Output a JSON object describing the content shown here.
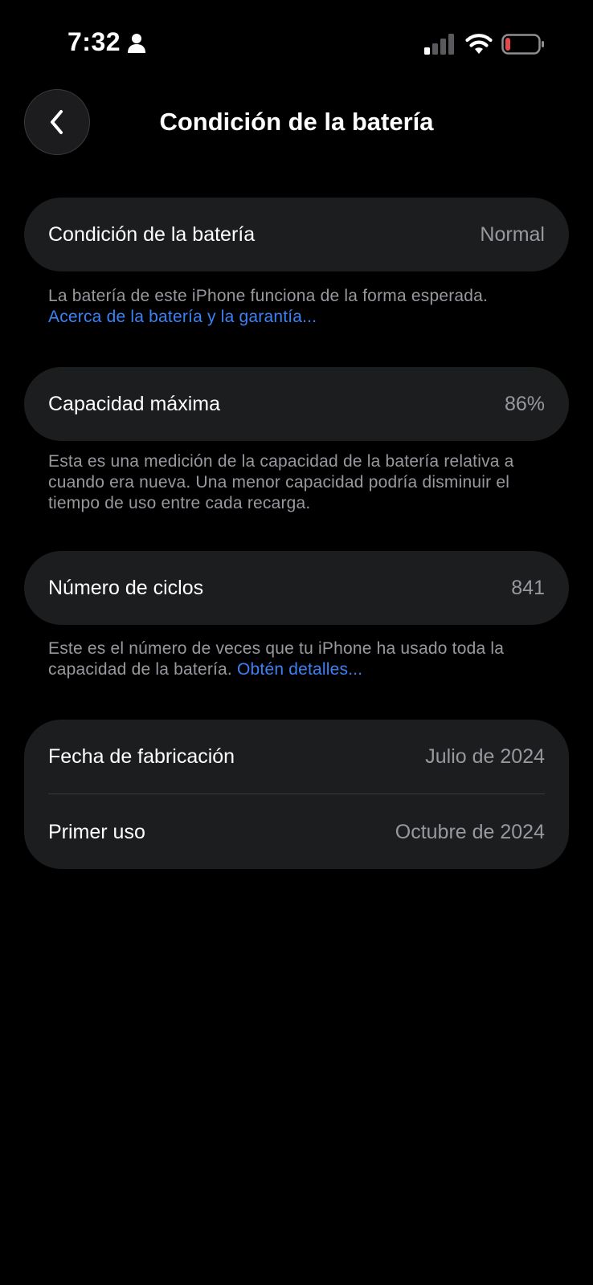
{
  "status_bar": {
    "time": "7:32",
    "battery_color": "#e5484d"
  },
  "header": {
    "title": "Condición de la batería"
  },
  "health": {
    "label": "Condición de la batería",
    "value": "Normal",
    "footnote": "La batería de este iPhone funciona de la forma esperada.",
    "link": "Acerca de la batería y la garantía..."
  },
  "capacity": {
    "label": "Capacidad máxima",
    "value": "86%",
    "footnote": "Esta es una medición de la capacidad de la batería relativa a cuando era nueva. Una menor capacidad podría disminuir el tiempo de uso entre cada recarga."
  },
  "cycles": {
    "label": "Número de ciclos",
    "value": "841",
    "footnote": "Este es el número de veces que tu iPhone ha usado toda la capacidad de la batería.",
    "link": "Obtén detalles..."
  },
  "dates": {
    "manufacture_label": "Fecha de fabricación",
    "manufacture_value": "Julio de 2024",
    "first_use_label": "Primer uso",
    "first_use_value": "Octubre de 2024"
  },
  "colors": {
    "background": "#000000",
    "card": "#1c1d1e",
    "link": "#3b82f6",
    "secondary_text": "#98989e"
  }
}
